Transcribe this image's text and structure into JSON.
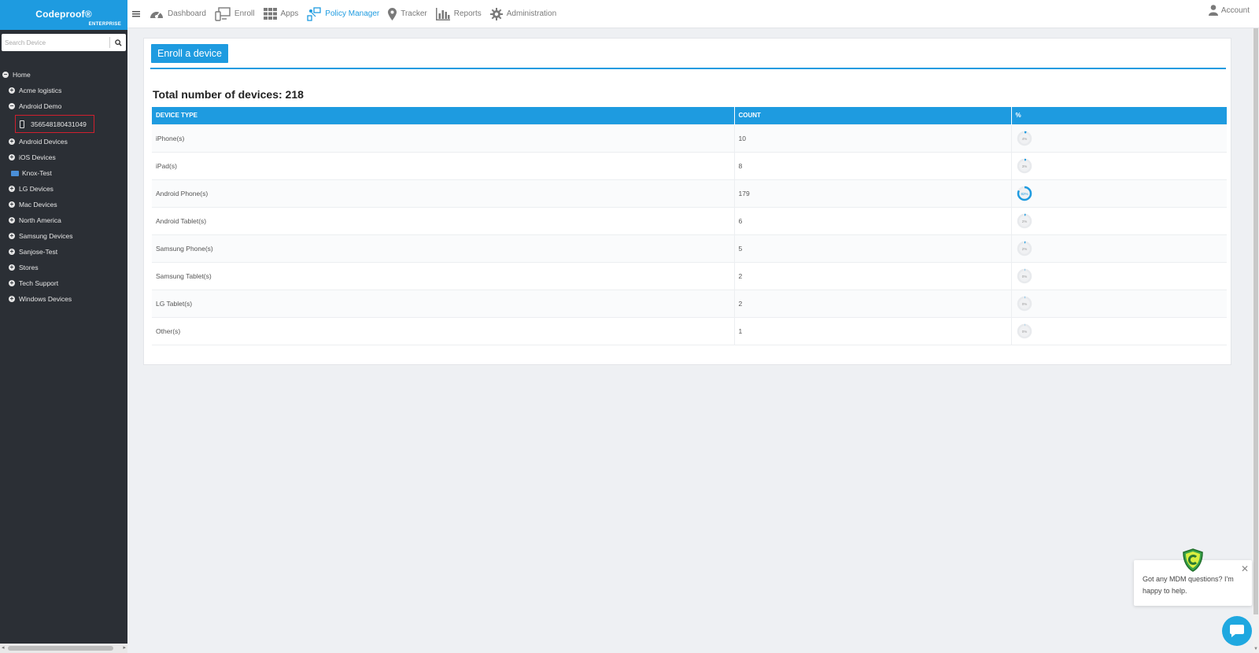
{
  "brand": {
    "name": "Codeproof®",
    "edition": "ENTERPRISE"
  },
  "search": {
    "placeholder": "Search Device"
  },
  "tree": {
    "home": "Home",
    "acme": "Acme logistics",
    "android_demo": "Android Demo",
    "device_id": "356548180431049",
    "android_devices": "Android Devices",
    "ios_devices": "iOS Devices",
    "knox_test": "Knox-Test",
    "lg_devices": "LG Devices",
    "mac_devices": "Mac Devices",
    "north_america": "North America",
    "samsung_devices": "Samsung Devices",
    "sanjose_test": "Sanjose-Test",
    "stores": "Stores",
    "tech_support": "Tech Support",
    "windows_devices": "Windows Devices"
  },
  "nav": {
    "dashboard": "Dashboard",
    "enroll": "Enroll",
    "apps": "Apps",
    "policy_manager": "Policy Manager",
    "tracker": "Tracker",
    "reports": "Reports",
    "administration": "Administration",
    "account": "Account"
  },
  "main": {
    "enroll_button": "Enroll a device",
    "total_label": "Total number of devices: 218",
    "columns": [
      "DEVICE TYPE",
      "COUNT",
      "%"
    ],
    "rows": [
      {
        "type": "iPhone(s)",
        "count": "10",
        "pct_label": "4%",
        "fraction": 0.046
      },
      {
        "type": "iPad(s)",
        "count": "8",
        "pct_label": "3%",
        "fraction": 0.037
      },
      {
        "type": "Android Phone(s)",
        "count": "179",
        "pct_label": "82%",
        "fraction": 0.82
      },
      {
        "type": "Android Tablet(s)",
        "count": "6",
        "pct_label": "2%",
        "fraction": 0.028
      },
      {
        "type": "Samsung Phone(s)",
        "count": "5",
        "pct_label": "2%",
        "fraction": 0.023
      },
      {
        "type": "Samsung Tablet(s)",
        "count": "2",
        "pct_label": "0%",
        "fraction": 0.009
      },
      {
        "type": "LG Tablet(s)",
        "count": "2",
        "pct_label": "0%",
        "fraction": 0.009
      },
      {
        "type": "Other(s)",
        "count": "1",
        "pct_label": "0%",
        "fraction": 0.005
      }
    ]
  },
  "chat": {
    "message": "Got any MDM questions? I'm happy to help."
  },
  "colors": {
    "accent": "#1e9be0",
    "sidebar": "#2b2f35",
    "highlight_border": "#d0202e"
  }
}
